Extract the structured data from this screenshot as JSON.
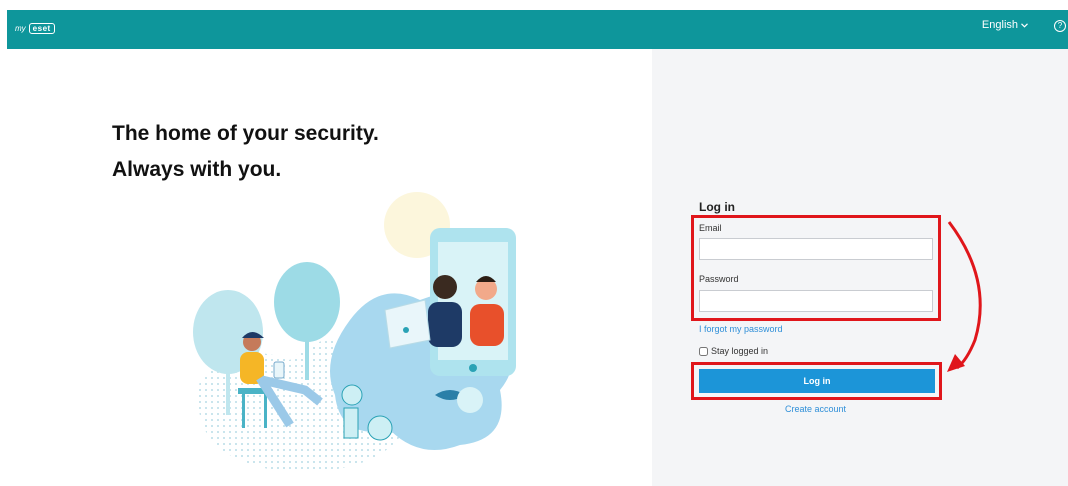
{
  "header": {
    "logo_prefix": "my",
    "logo_brand": "eset",
    "language": "English",
    "help_icon": "help-icon",
    "color": "#0e969b"
  },
  "hero": {
    "line1": "The home of your security.",
    "line2": "Always with you."
  },
  "login": {
    "title": "Log in",
    "email_label": "Email",
    "email_value": "",
    "password_label": "Password",
    "password_value": "",
    "forgot_link": "I forgot my password",
    "stay_logged_in": "Stay logged in",
    "submit_label": "Log in",
    "create_account": "Create account",
    "button_color": "#1c95d8"
  },
  "annotations": {
    "highlight_color": "#e0161b"
  }
}
